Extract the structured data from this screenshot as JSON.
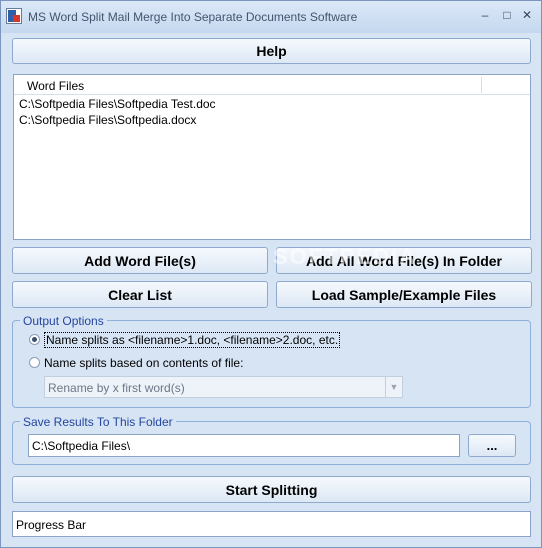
{
  "window": {
    "title": "MS Word Split Mail Merge Into Separate Documents Software",
    "minimize_glyph": "–",
    "maximize_glyph": "□",
    "close_glyph": "✕"
  },
  "help_button": "Help",
  "file_list": {
    "column_header": "Word Files",
    "items": [
      "C:\\Softpedia Files\\Softpedia Test.doc",
      "C:\\Softpedia Files\\Softpedia.docx"
    ]
  },
  "buttons": {
    "add_word_files": "Add Word File(s)",
    "add_all_in_folder": "Add All Word File(s) In Folder",
    "clear_list": "Clear List",
    "load_sample": "Load Sample/Example Files",
    "browse": "...",
    "start_splitting": "Start Splitting"
  },
  "watermark": "SOFTPEDIA",
  "output_options": {
    "legend": "Output Options",
    "option_filename": "Name splits as <filename>1.doc, <filename>2.doc, etc.",
    "option_contents": "Name splits based on contents of file:",
    "selected": "option_filename",
    "rename_select_value": "Rename by x first word(s)"
  },
  "save_results": {
    "legend": "Save Results To This Folder",
    "folder_value": "C:\\Softpedia Files\\"
  },
  "progress": {
    "label": "Progress Bar"
  },
  "colors": {
    "window_bg": "#d6e4f4",
    "legend_text": "#2646a0",
    "button_border": "#8ea9cd"
  }
}
